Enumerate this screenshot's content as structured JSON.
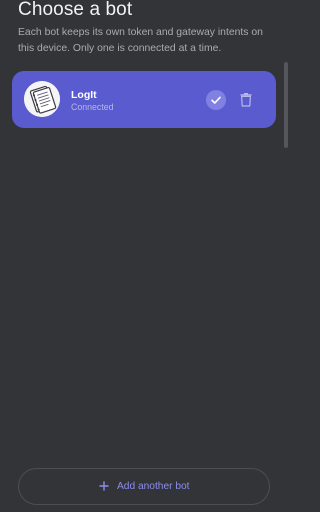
{
  "header": {
    "title": "Choose a bot",
    "subtitle": "Each bot keeps its own token and gateway intents on this device. Only one is connected at a time."
  },
  "bots": [
    {
      "name": "LogIt",
      "status": "Connected",
      "selected": true,
      "avatar_icon": "notebook-icon",
      "selected_icon": "check-icon",
      "delete_icon": "trash-icon"
    }
  ],
  "footer": {
    "add_label": "Add another bot",
    "add_icon": "plus-icon"
  },
  "colors": {
    "background": "#333438",
    "card": "#5b5bd0",
    "accent": "#8c8cf0",
    "check_circle": "#8181e2"
  }
}
